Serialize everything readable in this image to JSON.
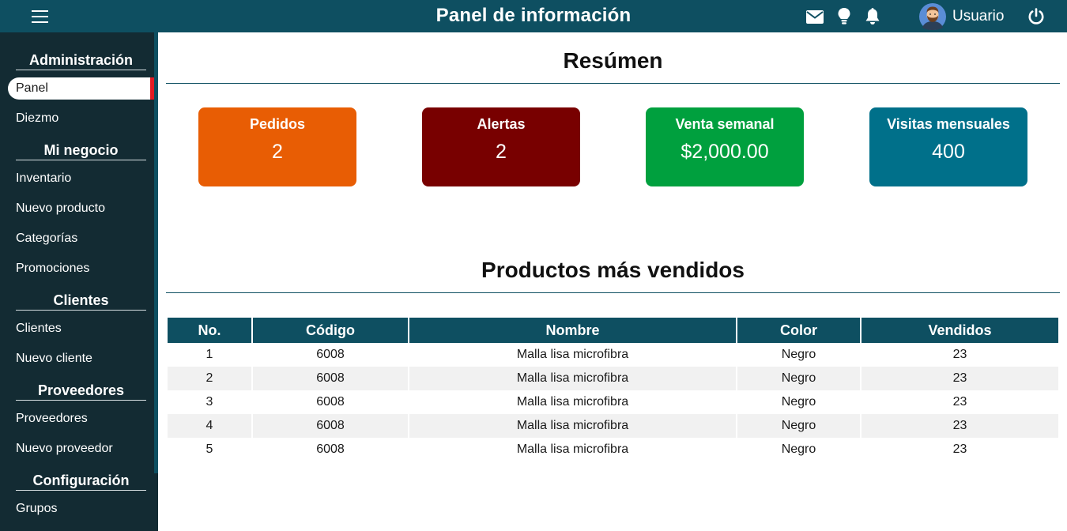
{
  "header": {
    "title": "Panel de información",
    "user_name": "Usuario",
    "icons": [
      "menu-icon",
      "mail-icon",
      "lightbulb-icon",
      "bell-icon",
      "avatar",
      "power-icon"
    ],
    "brand_color": "#0e4f61"
  },
  "sidebar": {
    "sections": [
      {
        "title": "Administración",
        "items": [
          {
            "label": "Panel",
            "active": true
          },
          {
            "label": "Diezmo"
          }
        ]
      },
      {
        "title": "Mi negocio",
        "items": [
          {
            "label": "Inventario"
          },
          {
            "label": "Nuevo producto"
          },
          {
            "label": "Categorías"
          },
          {
            "label": "Promociones"
          }
        ]
      },
      {
        "title": "Clientes",
        "items": [
          {
            "label": "Clientes"
          },
          {
            "label": "Nuevo cliente"
          }
        ]
      },
      {
        "title": "Proveedores",
        "items": [
          {
            "label": "Proveedores"
          },
          {
            "label": "Nuevo proveedor"
          }
        ]
      },
      {
        "title": "Configuración",
        "items": [
          {
            "label": "Grupos"
          }
        ]
      }
    ],
    "background": "#132b33",
    "active_marker_color": "#e31b23"
  },
  "summary": {
    "title": "Resúmen",
    "cards": [
      {
        "title": "Pedidos",
        "value": "2",
        "color": "#e85d04"
      },
      {
        "title": "Alertas",
        "value": "2",
        "color": "#780000"
      },
      {
        "title": "Venta semanal",
        "value": "$2,000.00",
        "color": "#00a03e"
      },
      {
        "title": "Visitas mensuales",
        "value": "400",
        "color": "#00708a"
      }
    ]
  },
  "top_products": {
    "title": "Productos más vendidos",
    "columns": [
      "No.",
      "Código",
      "Nombre",
      "Color",
      "Vendidos"
    ],
    "rows": [
      [
        "1",
        "6008",
        "Malla lisa microfibra",
        "Negro",
        "23"
      ],
      [
        "2",
        "6008",
        "Malla lisa microfibra",
        "Negro",
        "23"
      ],
      [
        "3",
        "6008",
        "Malla lisa microfibra",
        "Negro",
        "23"
      ],
      [
        "4",
        "6008",
        "Malla lisa microfibra",
        "Negro",
        "23"
      ],
      [
        "5",
        "6008",
        "Malla lisa microfibra",
        "Negro",
        "23"
      ]
    ]
  }
}
